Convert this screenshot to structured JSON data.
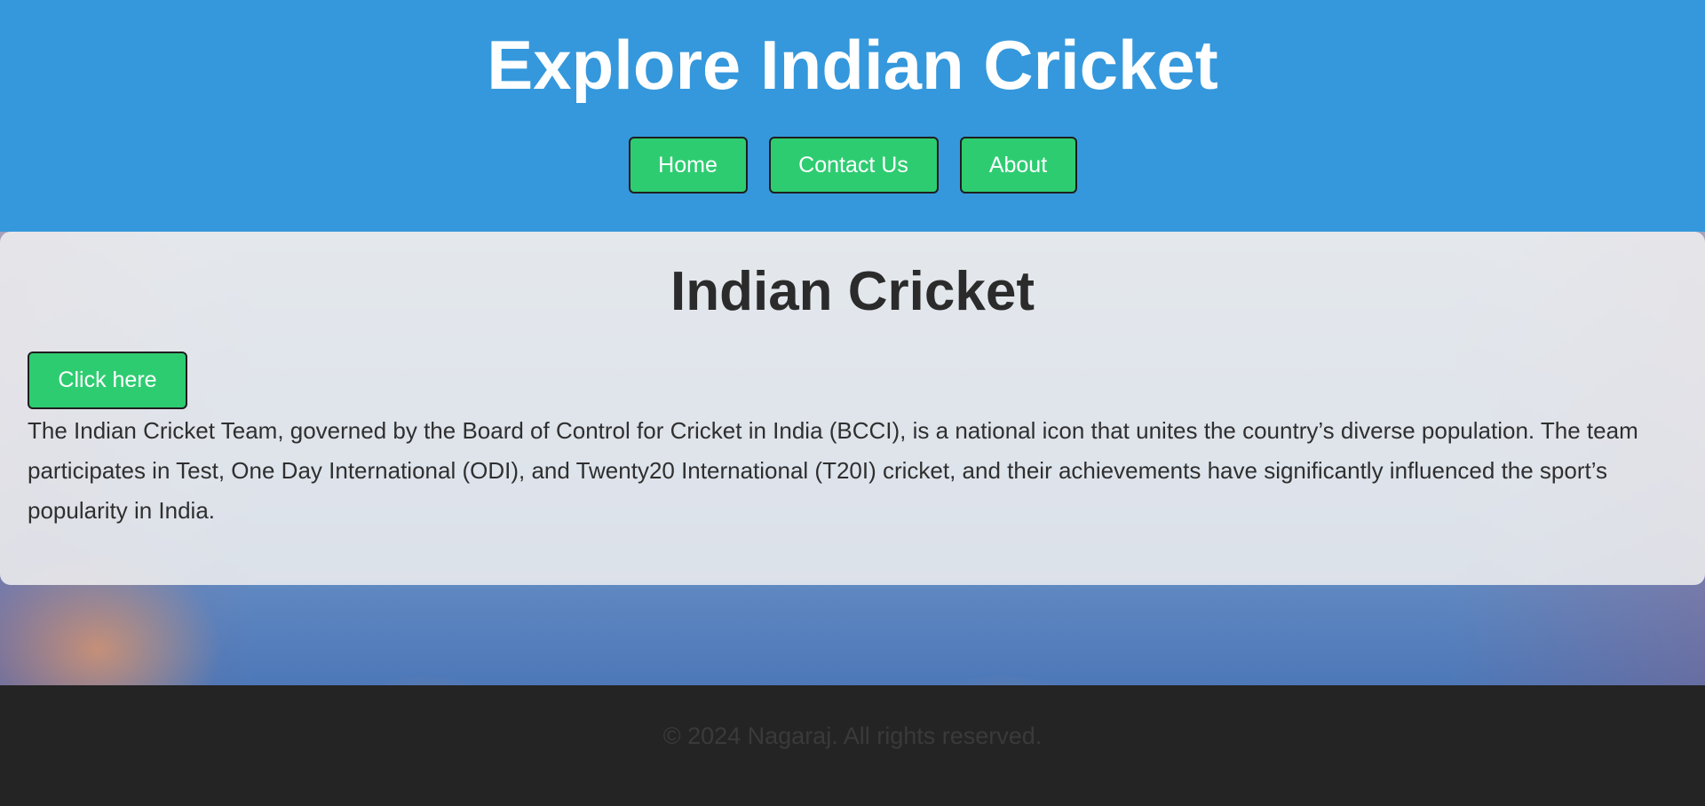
{
  "header": {
    "title": "Explore Indian Cricket",
    "nav": [
      {
        "label": "Home"
      },
      {
        "label": "Contact Us"
      },
      {
        "label": "About"
      }
    ]
  },
  "main": {
    "title": "Indian Cricket",
    "cta_label": "Click here",
    "description": "The Indian Cricket Team, governed by the Board of Control for Cricket in India (BCCI), is a national icon that unites the country’s diverse population. The team participates in Test, One Day International (ODI), and Twenty20 International (T20I) cricket, and their achievements have significantly influenced the sport’s popularity in India."
  },
  "footer": {
    "text": "© 2024 Nagaraj. All rights reserved."
  },
  "colors": {
    "header_bg": "#3598dc",
    "button_bg": "#2ecc71",
    "footer_bg": "#242424"
  }
}
